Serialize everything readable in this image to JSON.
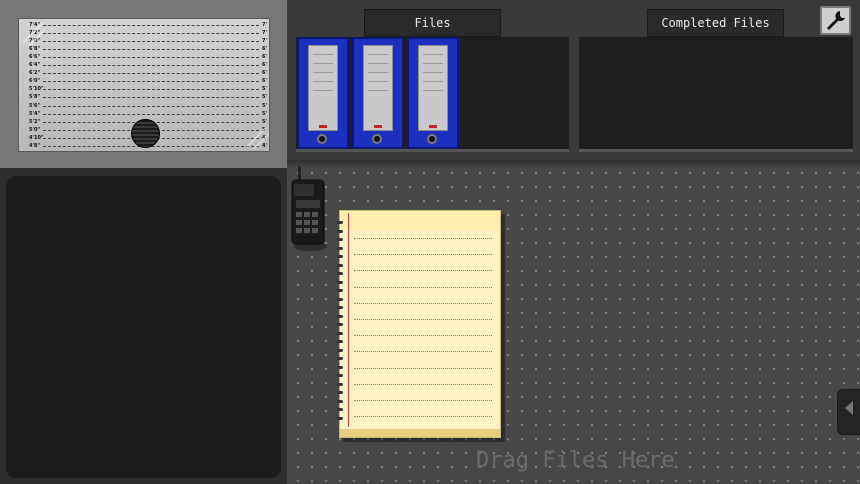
{
  "tabs": {
    "files_label": "Files",
    "completed_label": "Completed Files"
  },
  "settings": {
    "icon": "wrench-icon"
  },
  "lineup": {
    "left_marks": [
      "7'4\"",
      "7'2\"",
      "7'0\"",
      "6'8\"",
      "6'6\"",
      "6'4\"",
      "6'2\"",
      "6'0\"",
      "5'10\"",
      "5'8\"",
      "5'6\"",
      "5'4\"",
      "5'2\"",
      "5'0\"",
      "4'10\"",
      "4'8\""
    ],
    "right_marks": [
      "7'",
      "7'",
      "7'",
      "6'",
      "6'",
      "6'",
      "6'",
      "6'",
      "5'",
      "5'",
      "5'",
      "5'",
      "5'",
      "5'",
      "4'",
      "4'"
    ]
  },
  "binders": [
    {
      "color": "#1d2fbf"
    },
    {
      "color": "#1d2fbf"
    },
    {
      "color": "#1d2fbf"
    }
  ],
  "desk": {
    "drag_hint": "Drag Files Here"
  },
  "icons": {
    "radio": "walkie-talkie-icon",
    "drawer": "chevron-left-icon"
  }
}
